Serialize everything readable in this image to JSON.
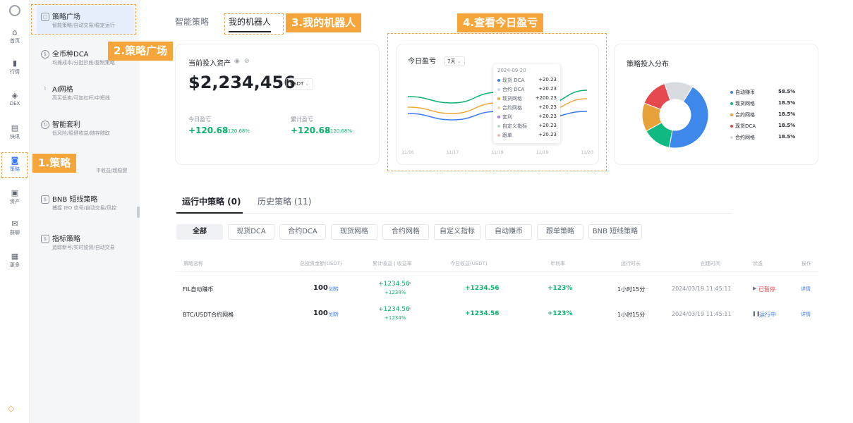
{
  "rail": {
    "items": [
      {
        "label": "首页",
        "icon": "home-icon"
      },
      {
        "label": "行情",
        "icon": "chart-icon"
      },
      {
        "label": "DEX",
        "icon": "dex-icon"
      },
      {
        "label": "快讯",
        "icon": "news-icon"
      },
      {
        "label": "策略",
        "icon": "robot-icon"
      },
      {
        "label": "资产",
        "icon": "wallet-icon"
      },
      {
        "label": "群聊",
        "icon": "chat-icon"
      },
      {
        "label": "更多",
        "icon": "grid-icon"
      }
    ]
  },
  "sidebar": {
    "items": [
      {
        "title": "策略广场",
        "sub": "智能策略/自动交易/稳定运行"
      },
      {
        "title": "全币种DCA",
        "sub": "均摊成本/分批抄底/复制策略"
      },
      {
        "title": "AI网格",
        "sub": "高买低卖/可加杠杆/中短线"
      },
      {
        "title": "智能套利",
        "sub": "低风险/稳健收益/随存随取"
      },
      {
        "title": "",
        "sub": "平收益/超稳健"
      },
      {
        "title": "BNB 短线策略",
        "sub": "捕捉 IEO 信号/自动交易/风控"
      },
      {
        "title": "指标策略",
        "sub": "追踪新号/实时监测/自动交易"
      }
    ]
  },
  "annotations": {
    "a1": "1.策略",
    "a2": "2.策略广场",
    "a3": "3.我的机器人",
    "a4": "4.查看今日盈亏"
  },
  "top_tabs": [
    "智能策略",
    "我的机器人"
  ],
  "assets": {
    "title": "当前投入资产",
    "value": "$2,234,456",
    "currency": "USDT",
    "today_label": "今日盈亏",
    "today_value": "+120.68",
    "today_pct": "+120.68%",
    "total_label": "累计盈亏",
    "total_value": "+120.68",
    "total_pct": "+120.68%"
  },
  "pnl_chart": {
    "title": "今日盈亏",
    "range": "7天",
    "tooltip": {
      "date": "2024-09-20",
      "rows": [
        {
          "name": "现货 DCA",
          "value": "+20.23",
          "color": "#3d7bf7"
        },
        {
          "name": "合约 DCA",
          "value": "+20.23",
          "color": "#c9d7f2"
        },
        {
          "name": "现货网格",
          "value": "+200.23",
          "color": "#f0a83a"
        },
        {
          "name": "合约网格",
          "value": "+20.23",
          "color": "#e9d7a8"
        },
        {
          "name": "套利",
          "value": "+20.23",
          "color": "#a87de8"
        },
        {
          "name": "自定义指标",
          "value": "+20.23",
          "color": "#b6dccb"
        },
        {
          "name": "跟单",
          "value": "+20.23",
          "color": "#f4b8b8"
        }
      ]
    }
  },
  "chart_data": [
    {
      "type": "line",
      "title": "今日盈亏",
      "x": [
        "11/16",
        "11/17",
        "11/18",
        "11/19",
        "11/20"
      ],
      "series": [
        {
          "values": [
            28,
            22,
            30,
            24,
            30
          ],
          "color": "#3d7bf7"
        },
        {
          "values": [
            34,
            28,
            38,
            30,
            42
          ],
          "color": "#f0a83a"
        },
        {
          "values": [
            44,
            38,
            48,
            36,
            50
          ],
          "color": "#0ab26e"
        }
      ],
      "ylim": [
        0,
        60
      ]
    },
    {
      "type": "pie",
      "title": "策略投入分布",
      "labels": [
        "自动赚币",
        "现货网格",
        "合约网格",
        "现货DCA",
        "合约网格"
      ],
      "values": [
        58.5,
        18.5,
        18.5,
        18.5,
        18.5
      ],
      "value_labels": [
        "58.5%",
        "18.5%",
        "18.5%",
        "18.5%",
        "18.5%"
      ],
      "colors": [
        "#3d88ea",
        "#10b981",
        "#e8a23a",
        "#e5484d",
        "#d8dbe0"
      ]
    }
  ],
  "dist_title": "策略投入分布",
  "lower_tabs": [
    "运行中策略 (0)",
    "历史策略 (11)"
  ],
  "filters": [
    "全部",
    "现货DCA",
    "合约DCA",
    "现货网格",
    "合约网格",
    "自定义指标",
    "自动赚币",
    "跟单策略",
    "BNB 短线策略"
  ],
  "table": {
    "headers": [
      "策略名称",
      "总投资金额(USDT)",
      "累计收益 | 收益率",
      "今日收益(USDT)",
      "年利率",
      "运行时长",
      "创建时间",
      "状态",
      "操作"
    ],
    "rows": [
      {
        "name": "FIL自动赚币",
        "amount": "100",
        "transfer": "划转",
        "total": "+1234.56",
        "rate": "+1234%",
        "today": "+1234.56",
        "apy": "+123%",
        "dur": "1小时15分",
        "created": "2024/03/19 11:45:11",
        "status": "已暂停",
        "action": "详情"
      },
      {
        "name": "BTC/USDT合约网格",
        "amount": "100",
        "transfer": "划转",
        "total": "+1234.56",
        "rate": "+1234%",
        "today": "+1234.56",
        "apy": "+123%",
        "dur": "1小时15分",
        "created": "2024/03/19 11:45:11",
        "status": "运行中",
        "action": "详情"
      }
    ]
  }
}
